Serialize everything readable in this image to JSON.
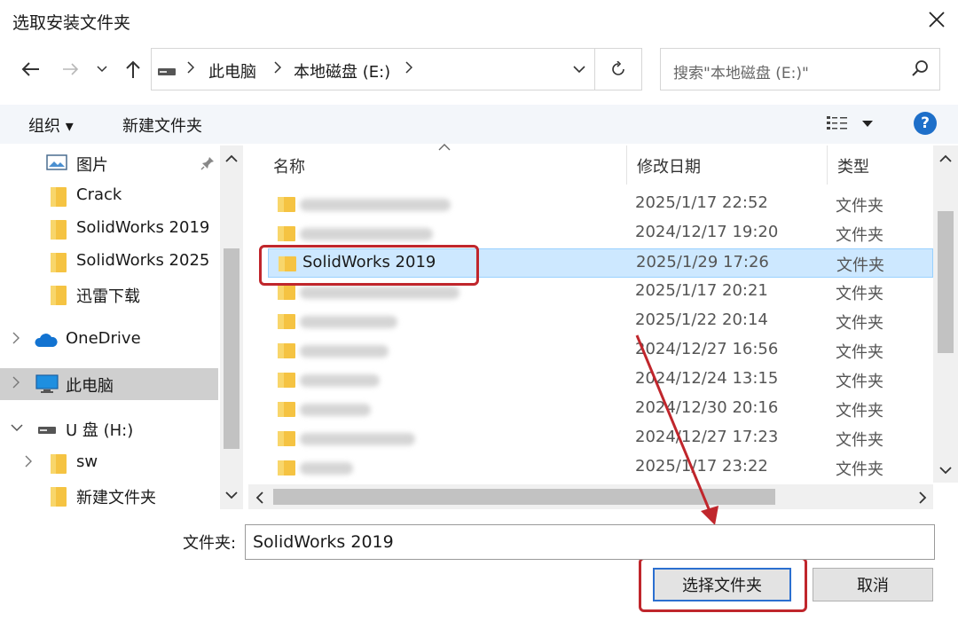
{
  "window": {
    "title": "选取安装文件夹"
  },
  "address": {
    "crumbs": [
      "此电脑",
      "本地磁盘 (E:)"
    ]
  },
  "search": {
    "placeholder": "搜索\"本地磁盘 (E:)\""
  },
  "toolbar": {
    "organize": "组织 ▾",
    "new_folder": "新建文件夹",
    "help": "?"
  },
  "sidebar": {
    "items": [
      {
        "label": "图片",
        "icon": "pictures-icon"
      },
      {
        "label": "Crack",
        "icon": "folder-icon"
      },
      {
        "label": "SolidWorks 2019",
        "icon": "folder-icon"
      },
      {
        "label": "SolidWorks 2025",
        "icon": "folder-icon"
      },
      {
        "label": "迅雷下载",
        "icon": "folder-icon"
      },
      {
        "label": "OneDrive",
        "icon": "onedrive-icon"
      },
      {
        "label": "此电脑",
        "icon": "computer-icon",
        "selected": true
      },
      {
        "label": "U 盘 (H:)",
        "icon": "drive-icon"
      },
      {
        "label": "sw",
        "icon": "folder-icon"
      },
      {
        "label": "新建文件夹",
        "icon": "folder-icon"
      }
    ]
  },
  "columns": {
    "name": "名称",
    "date": "修改日期",
    "type": "类型"
  },
  "files": [
    {
      "name": "",
      "date": "2025/1/17 22:52",
      "type": "文件夹"
    },
    {
      "name": "",
      "date": "2024/12/17 19:20",
      "type": "文件夹"
    },
    {
      "name": "SolidWorks 2019",
      "date": "2025/1/29 17:26",
      "type": "文件夹",
      "selected": true
    },
    {
      "name": "",
      "date": "2025/1/17 20:21",
      "type": "文件夹"
    },
    {
      "name": "",
      "date": "2025/1/22 20:14",
      "type": "文件夹"
    },
    {
      "name": "",
      "date": "2024/12/27 16:56",
      "type": "文件夹"
    },
    {
      "name": "",
      "date": "2024/12/24 13:15",
      "type": "文件夹"
    },
    {
      "name": "",
      "date": "2024/12/30 20:16",
      "type": "文件夹"
    },
    {
      "name": "",
      "date": "2024/12/27 17:23",
      "type": "文件夹"
    },
    {
      "name": "",
      "date": "2025/1/17 23:22",
      "type": "文件夹"
    }
  ],
  "footer": {
    "folder_label": "文件夹:",
    "folder_value": "SolidWorks 2019",
    "select_button": "选择文件夹",
    "cancel_button": "取消"
  },
  "colors": {
    "accent": "#1e6fc9",
    "selection": "#cde8ff",
    "annotation": "#c0262c",
    "folder": "#f5c342"
  }
}
